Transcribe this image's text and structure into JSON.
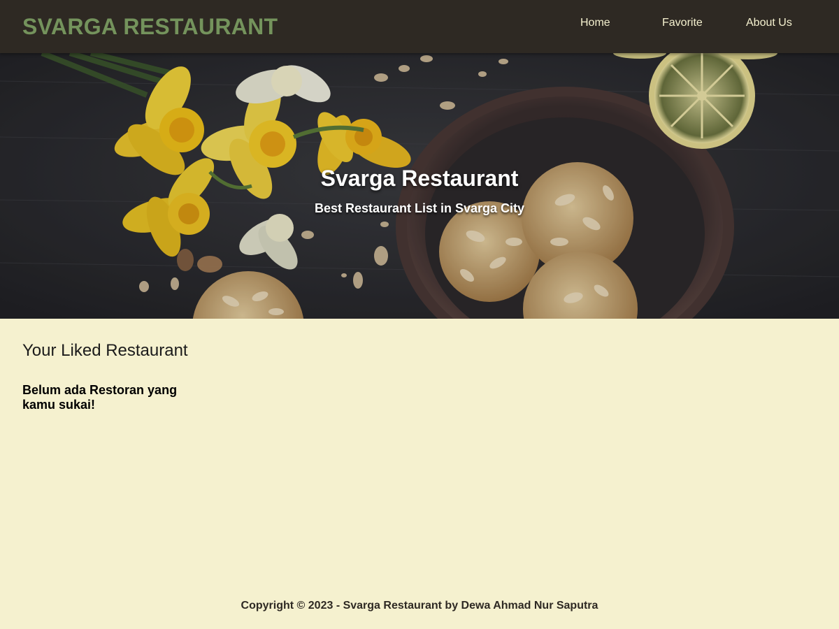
{
  "header": {
    "brand": "SVARGA RESTAURANT",
    "nav": {
      "home": "Home",
      "favorite": "Favorite",
      "about": "About Us"
    }
  },
  "hero": {
    "title": "Svarga Restaurant",
    "subtitle": "Best Restaurant List in Svarga City"
  },
  "main": {
    "section_title": "Your Liked Restaurant",
    "empty_message": "Belum ada Restoran yang kamu sukai!"
  },
  "footer": {
    "copyright": "Copyright © 2023 - Svarga Restaurant by Dewa Ahmad Nur Saputra"
  },
  "colors": {
    "header_bg": "#2e2923",
    "brand": "#74935c",
    "nav_text": "#f5f1cf",
    "page_bg": "#f5f1cf"
  }
}
